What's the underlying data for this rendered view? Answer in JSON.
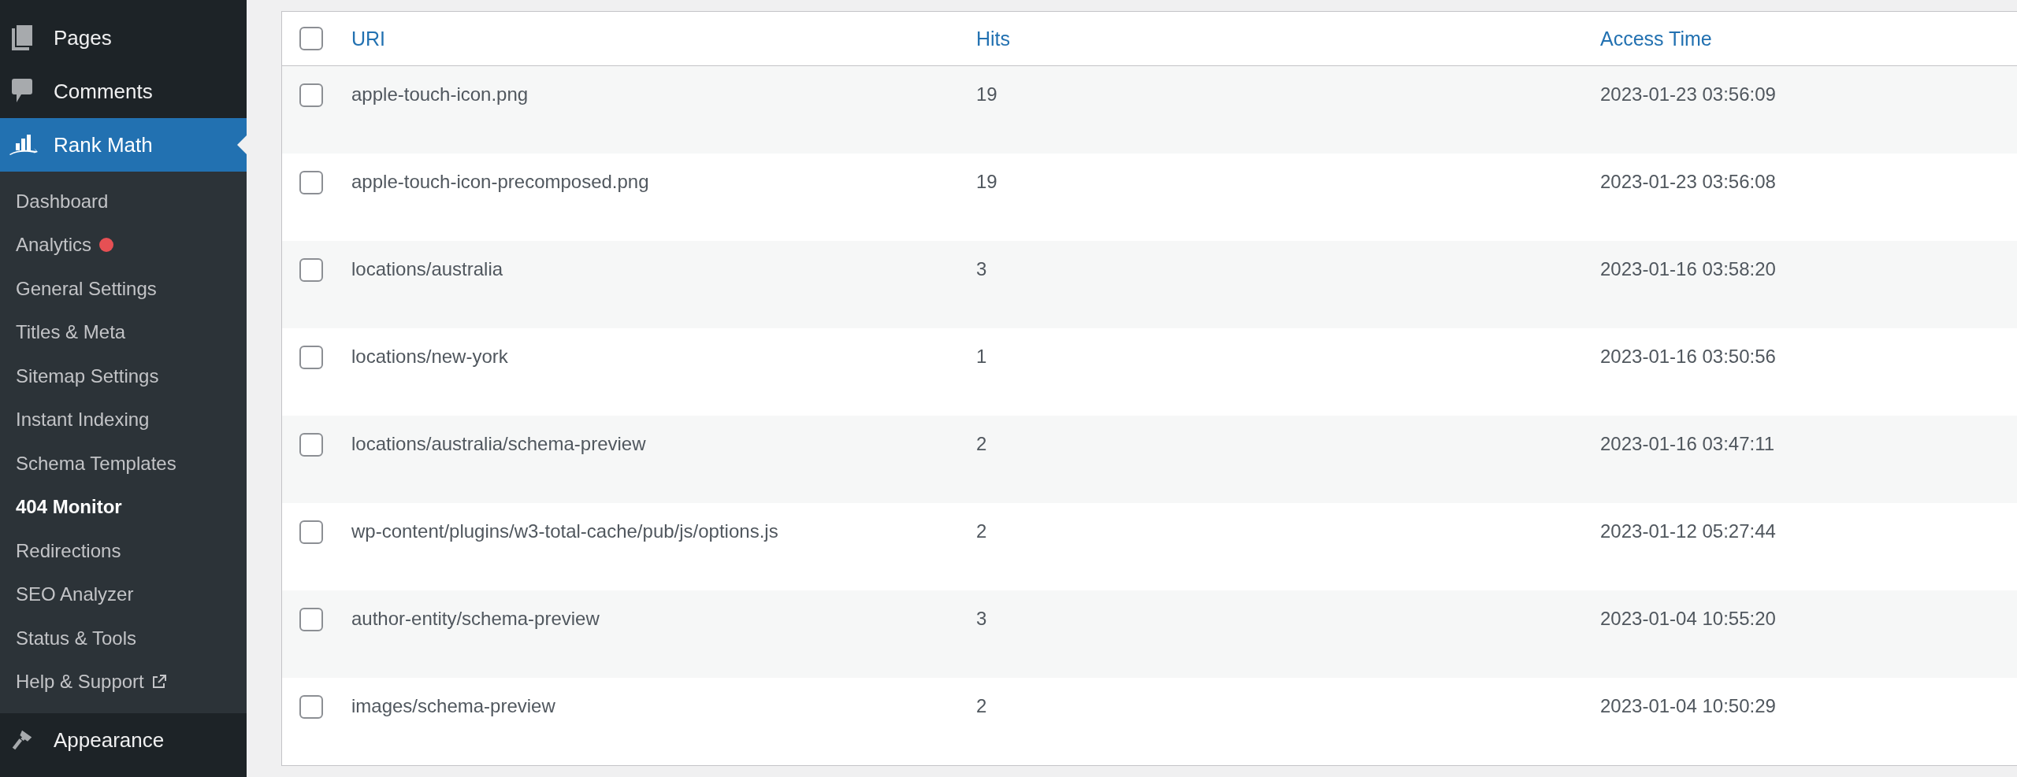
{
  "sidebar": {
    "menu_top": [
      {
        "label": "Pages",
        "kind": "pages"
      },
      {
        "label": "Comments",
        "kind": "comments"
      }
    ],
    "active_menu": {
      "label": "Rank Math"
    },
    "submenu": [
      {
        "label": "Dashboard",
        "selected": false,
        "kind": "plain"
      },
      {
        "label": "Analytics",
        "selected": false,
        "kind": "notification"
      },
      {
        "label": "General Settings",
        "selected": false,
        "kind": "plain"
      },
      {
        "label": "Titles & Meta",
        "selected": false,
        "kind": "plain"
      },
      {
        "label": "Sitemap Settings",
        "selected": false,
        "kind": "plain"
      },
      {
        "label": "Instant Indexing",
        "selected": false,
        "kind": "plain"
      },
      {
        "label": "Schema Templates",
        "selected": false,
        "kind": "plain"
      },
      {
        "label": "404 Monitor",
        "selected": true,
        "kind": "plain"
      },
      {
        "label": "Redirections",
        "selected": false,
        "kind": "plain"
      },
      {
        "label": "SEO Analyzer",
        "selected": false,
        "kind": "plain"
      },
      {
        "label": "Status & Tools",
        "selected": false,
        "kind": "plain"
      },
      {
        "label": "Help & Support",
        "selected": false,
        "kind": "external"
      }
    ],
    "menu_bottom": [
      {
        "label": "Appearance",
        "kind": "appearance"
      }
    ]
  },
  "table": {
    "select_all_checked": false,
    "columns": [
      {
        "label": "URI"
      },
      {
        "label": "Hits"
      },
      {
        "label": "Access Time"
      }
    ],
    "rows": [
      {
        "uri": "apple-touch-icon.png",
        "hits": "19",
        "access_time": "2023-01-23 03:56:09",
        "checked": false
      },
      {
        "uri": "apple-touch-icon-precomposed.png",
        "hits": "19",
        "access_time": "2023-01-23 03:56:08",
        "checked": false
      },
      {
        "uri": "locations/australia",
        "hits": "3",
        "access_time": "2023-01-16 03:58:20",
        "checked": false
      },
      {
        "uri": "locations/new-york",
        "hits": "1",
        "access_time": "2023-01-16 03:50:56",
        "checked": false
      },
      {
        "uri": "locations/australia/schema-preview",
        "hits": "2",
        "access_time": "2023-01-16 03:47:11",
        "checked": false
      },
      {
        "uri": "wp-content/plugins/w3-total-cache/pub/js/options.js",
        "hits": "2",
        "access_time": "2023-01-12 05:27:44",
        "checked": false
      },
      {
        "uri": "author-entity/schema-preview",
        "hits": "3",
        "access_time": "2023-01-04 10:55:20",
        "checked": false
      },
      {
        "uri": "images/schema-preview",
        "hits": "2",
        "access_time": "2023-01-04 10:50:29",
        "checked": false
      }
    ]
  }
}
